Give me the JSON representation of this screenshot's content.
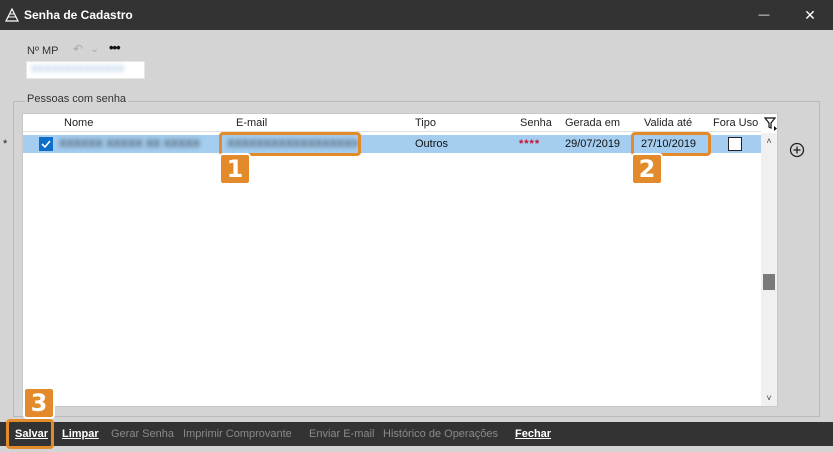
{
  "window": {
    "title": "Senha de Cadastro",
    "minimize_glyph": "—",
    "close_glyph": "✕"
  },
  "nmp": {
    "label": "Nº MP",
    "value": "XXXXXXXXXXXXXX"
  },
  "group": {
    "label": "Pessoas com senha"
  },
  "grid": {
    "columns": [
      "Nome",
      "E-mail",
      "Tipo",
      "Senha",
      "Gerada em",
      "Valida até",
      "Fora Uso"
    ],
    "rows": [
      {
        "indicator": "*",
        "selected": true,
        "nome": "XXXXXX XXXXX XX XXXXX",
        "email": "XXXXXXXXXXXXXXXXXXXXX",
        "tipo": "Outros",
        "senha": "****",
        "gerada_em": "29/07/2019",
        "valida_ate": "27/10/2019",
        "fora_uso": false
      }
    ]
  },
  "scrollbar": {
    "up_glyph": "˄",
    "down_glyph": "˅"
  },
  "callouts": [
    {
      "number": "1",
      "target": "email"
    },
    {
      "number": "2",
      "target": "valida_ate"
    },
    {
      "number": "3",
      "target": "salvar"
    }
  ],
  "actions": {
    "salvar": "Salvar",
    "limpar": "Limpar",
    "gerar_senha": "Gerar Senha",
    "imprimir_comprovante": "Imprimir Comprovante",
    "enviar_email": "Enviar E-mail",
    "historico": "Histórico de Operações",
    "fechar": "Fechar"
  },
  "colors": {
    "titlebar": "#333333",
    "accent": "#e38b2a",
    "selected_row": "#a4cdef",
    "checkbox": "#0e6fc9",
    "password_mask": "#c8102e"
  }
}
